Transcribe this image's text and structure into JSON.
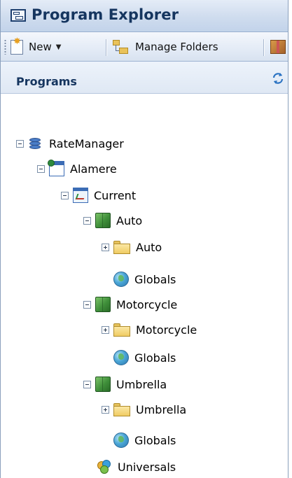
{
  "window": {
    "title": "Program Explorer"
  },
  "toolbar": {
    "new_label": "New",
    "new_dropdown": "▼",
    "manage_folders_label": "Manage Folders"
  },
  "section": {
    "title": "Programs"
  },
  "tree": [
    {
      "label": "RateManager",
      "icon": "database-icon",
      "toggle": "minus"
    },
    {
      "label": "Alamere",
      "icon": "application-icon",
      "toggle": "minus"
    },
    {
      "label": "Current",
      "icon": "version-icon",
      "toggle": "minus"
    },
    {
      "label": "Auto",
      "icon": "cube-icon",
      "toggle": "minus"
    },
    {
      "label": "Auto",
      "icon": "folder-icon",
      "toggle": "plus"
    },
    {
      "label": "Globals",
      "icon": "globe-icon",
      "toggle": "none"
    },
    {
      "label": "Motorcycle",
      "icon": "cube-icon",
      "toggle": "minus"
    },
    {
      "label": "Motorcycle",
      "icon": "folder-icon",
      "toggle": "plus"
    },
    {
      "label": "Globals",
      "icon": "globe-icon",
      "toggle": "none"
    },
    {
      "label": "Umbrella",
      "icon": "cube-icon",
      "toggle": "minus"
    },
    {
      "label": "Umbrella",
      "icon": "folder-icon",
      "toggle": "plus"
    },
    {
      "label": "Globals",
      "icon": "globe-icon",
      "toggle": "none"
    },
    {
      "label": "Universals",
      "icon": "universals-icon",
      "toggle": "none"
    }
  ]
}
